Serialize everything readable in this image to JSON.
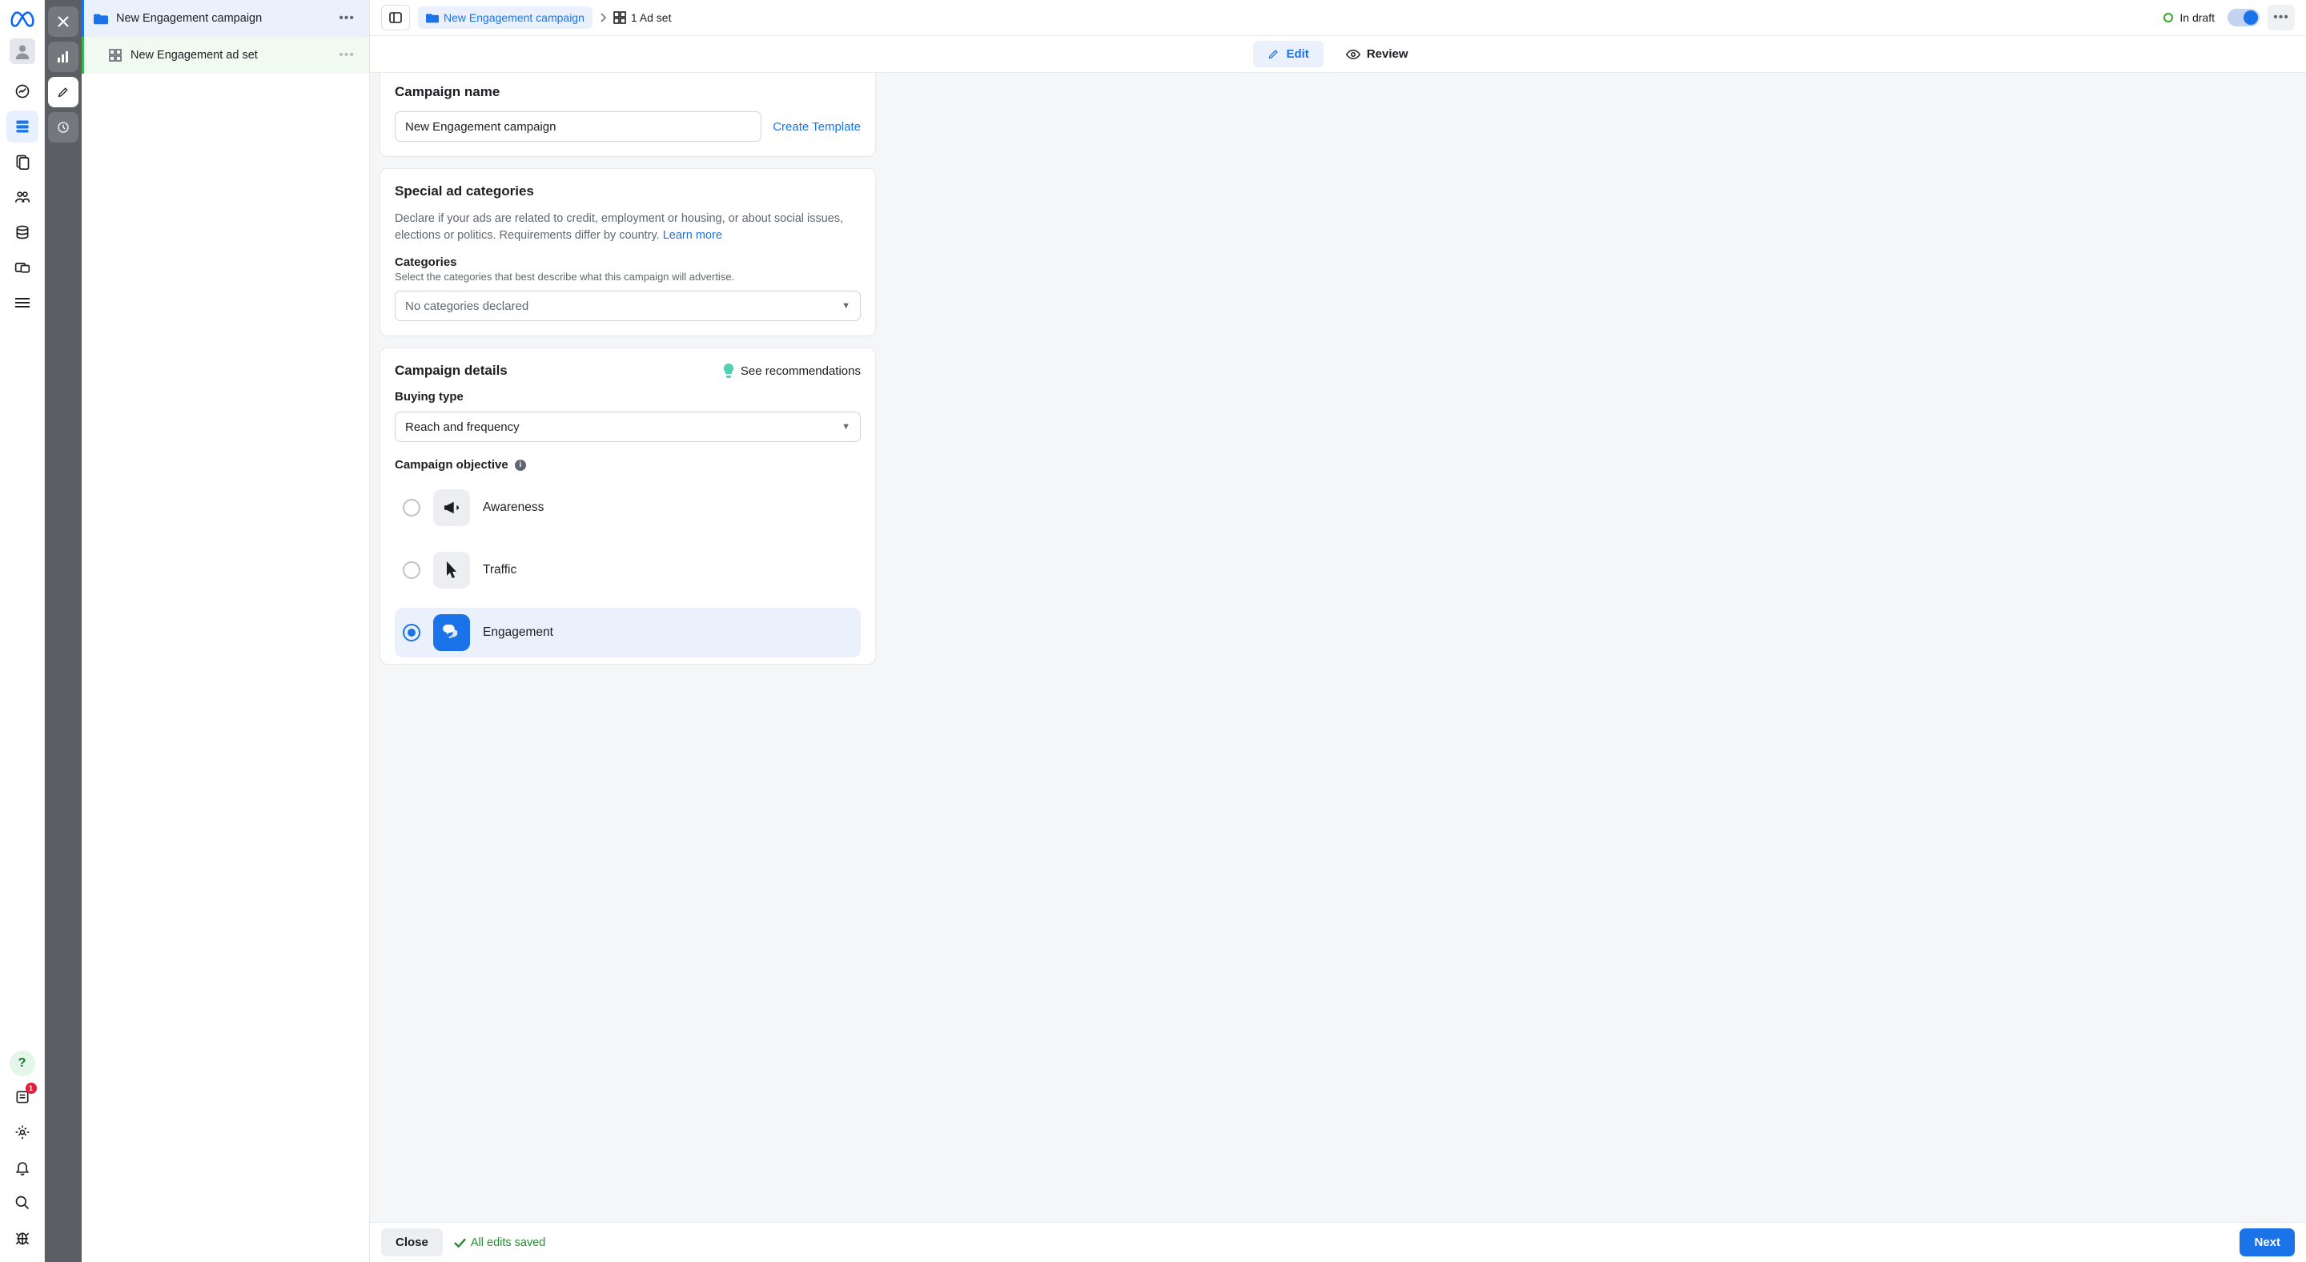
{
  "rail": {
    "notif_badge": "1"
  },
  "tree": {
    "campaign_label": "New Engagement campaign",
    "adset_label": "New Engagement ad set"
  },
  "topbar": {
    "breadcrumb_campaign": "New Engagement campaign",
    "breadcrumb_adset": "1 Ad set",
    "draft_label": "In draft"
  },
  "tabs": {
    "edit": "Edit",
    "review": "Review"
  },
  "campaign_name": {
    "heading": "Campaign name",
    "value": "New Engagement campaign",
    "create_template": "Create Template"
  },
  "special_categories": {
    "heading": "Special ad categories",
    "description": "Declare if your ads are related to credit, employment or housing, or about social issues, elections or politics. Requirements differ by country. ",
    "learn_more": "Learn more",
    "sub_label": "Categories",
    "sub_desc": "Select the categories that best describe what this campaign will advertise.",
    "placeholder": "No categories declared"
  },
  "campaign_details": {
    "heading": "Campaign details",
    "recommendations": "See recommendations",
    "buying_type_label": "Buying type",
    "buying_type_value": "Reach and frequency",
    "objective_label": "Campaign objective",
    "objectives": {
      "awareness": "Awareness",
      "traffic": "Traffic",
      "engagement": "Engagement"
    }
  },
  "footer": {
    "close": "Close",
    "saved": "All edits saved",
    "next": "Next"
  }
}
